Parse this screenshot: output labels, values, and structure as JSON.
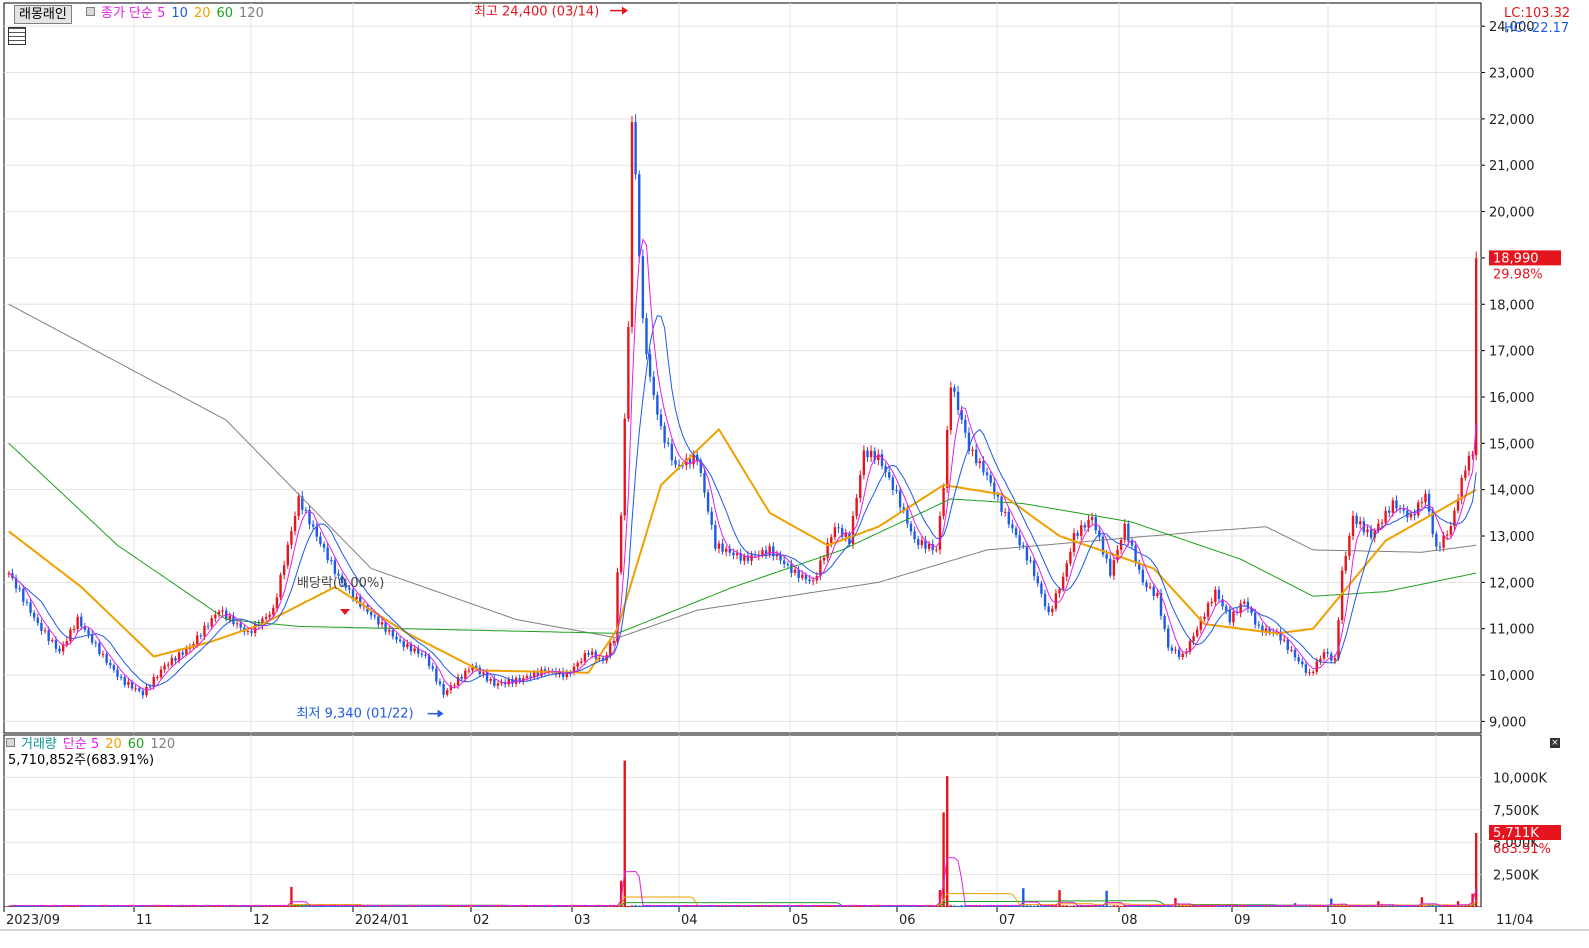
{
  "header": {
    "title": "래몽래인",
    "ma_legend": [
      {
        "label": "종가 단순 5",
        "color": "#e61ee6"
      },
      {
        "label": "10",
        "color": "#1e5ae6"
      },
      {
        "label": "20",
        "color": "#f0a000"
      },
      {
        "label": "60",
        "color": "#1ea01e"
      },
      {
        "label": "120",
        "color": "#808080"
      }
    ],
    "lc": "LC:103.32",
    "hc": "HC:-22.17"
  },
  "volume_header": {
    "legend": [
      {
        "label": "거래량",
        "color": "#0a9696"
      },
      {
        "label": "단순 5",
        "color": "#e61ee6"
      },
      {
        "label": "20",
        "color": "#f0a000"
      },
      {
        "label": "60",
        "color": "#1ea01e"
      },
      {
        "label": "120",
        "color": "#808080"
      }
    ],
    "volume_text": "5,710,852주(683.91%)"
  },
  "annotations": {
    "high": "최고 24,400 (03/14)",
    "low": "최저 9,340 (01/22)",
    "dividend": "배당락(0.00%)"
  },
  "price_badge": {
    "value": "18,990",
    "pct": "29.98%"
  },
  "volume_badge": {
    "value": "5,711K",
    "pct": "683.91%"
  },
  "chart_data": {
    "type": "candlestick",
    "price_axis": {
      "ylim": [
        8750,
        24500
      ],
      "ticks": [
        "9,000",
        "10,000",
        "11,000",
        "12,000",
        "13,000",
        "14,000",
        "15,000",
        "16,000",
        "17,000",
        "18,000",
        "19,000",
        "20,000",
        "21,000",
        "22,000",
        "23,000",
        "24,000"
      ]
    },
    "volume_axis": {
      "ylim": [
        0,
        12500
      ],
      "ticks": [
        "2,500K",
        "5,000K",
        "7,500K",
        "10,000K"
      ]
    },
    "x_axis": {
      "labels": [
        "2023/09",
        "11",
        "12",
        "2024/01",
        "02",
        "03",
        "04",
        "05",
        "06",
        "07",
        "08",
        "09",
        "10",
        "11",
        "11/04"
      ]
    },
    "colors": {
      "up": "#e6141e",
      "down": "#1e5ae6",
      "ma5": "#e61ee6",
      "ma10": "#1e5ae6",
      "ma20": "#f0a000",
      "ma60": "#1ea01e",
      "ma120": "#808080"
    },
    "close_knots": [
      [
        0,
        12200
      ],
      [
        8,
        11100
      ],
      [
        14,
        10500
      ],
      [
        19,
        11200
      ],
      [
        26,
        10400
      ],
      [
        31,
        9900
      ],
      [
        37,
        9600
      ],
      [
        43,
        10200
      ],
      [
        50,
        10600
      ],
      [
        58,
        11400
      ],
      [
        66,
        10900
      ],
      [
        73,
        11400
      ],
      [
        80,
        13800
      ],
      [
        85,
        13000
      ],
      [
        91,
        12100
      ],
      [
        95,
        11700
      ],
      [
        100,
        11300
      ],
      [
        108,
        10700
      ],
      [
        115,
        10400
      ],
      [
        120,
        9600
      ],
      [
        128,
        10200
      ],
      [
        134,
        9800
      ],
      [
        141,
        9900
      ],
      [
        148,
        10100
      ],
      [
        154,
        10000
      ],
      [
        160,
        10500
      ],
      [
        164,
        10300
      ],
      [
        167,
        10800
      ],
      [
        169,
        13500
      ],
      [
        171,
        17500
      ],
      [
        172,
        22000
      ],
      [
        173,
        20700
      ],
      [
        175,
        17600
      ],
      [
        177,
        16400
      ],
      [
        180,
        15300
      ],
      [
        184,
        14500
      ],
      [
        190,
        14700
      ],
      [
        195,
        12800
      ],
      [
        203,
        12500
      ],
      [
        210,
        12700
      ],
      [
        217,
        12200
      ],
      [
        222,
        12000
      ],
      [
        228,
        13200
      ],
      [
        232,
        12900
      ],
      [
        236,
        14800
      ],
      [
        240,
        14700
      ],
      [
        245,
        13900
      ],
      [
        250,
        12900
      ],
      [
        256,
        12700
      ],
      [
        258,
        14100
      ],
      [
        260,
        16300
      ],
      [
        263,
        15500
      ],
      [
        265,
        14900
      ],
      [
        270,
        14300
      ],
      [
        274,
        13600
      ],
      [
        278,
        13000
      ],
      [
        282,
        12400
      ],
      [
        287,
        11300
      ],
      [
        291,
        12100
      ],
      [
        294,
        13000
      ],
      [
        299,
        13400
      ],
      [
        304,
        12200
      ],
      [
        308,
        13200
      ],
      [
        313,
        12000
      ],
      [
        317,
        11700
      ],
      [
        320,
        10600
      ],
      [
        324,
        10400
      ],
      [
        328,
        11000
      ],
      [
        333,
        11800
      ],
      [
        337,
        11200
      ],
      [
        341,
        11600
      ],
      [
        345,
        11000
      ],
      [
        350,
        10900
      ],
      [
        355,
        10400
      ],
      [
        359,
        10000
      ],
      [
        363,
        10500
      ],
      [
        366,
        10300
      ],
      [
        368,
        12200
      ],
      [
        371,
        13400
      ],
      [
        376,
        13000
      ],
      [
        382,
        13700
      ],
      [
        387,
        13400
      ],
      [
        391,
        13900
      ],
      [
        394,
        12700
      ],
      [
        398,
        13200
      ],
      [
        402,
        14500
      ],
      [
        404,
        14800
      ],
      [
        405,
        18990
      ]
    ],
    "volume_spikes": [
      [
        78,
        1550
      ],
      [
        170,
        11300
      ],
      [
        258,
        7300
      ],
      [
        259,
        10100
      ],
      [
        280,
        1450
      ],
      [
        290,
        1300
      ],
      [
        303,
        1250
      ],
      [
        322,
        700
      ],
      [
        355,
        300
      ],
      [
        365,
        650
      ],
      [
        378,
        450
      ],
      [
        390,
        750
      ],
      [
        400,
        450
      ],
      [
        405,
        5711
      ]
    ],
    "ma120_knots": [
      [
        0,
        18000
      ],
      [
        60,
        15500
      ],
      [
        100,
        12300
      ],
      [
        140,
        11200
      ],
      [
        168,
        10800
      ],
      [
        190,
        11400
      ],
      [
        240,
        12000
      ],
      [
        270,
        12700
      ],
      [
        330,
        13100
      ],
      [
        347,
        13200
      ],
      [
        360,
        12700
      ],
      [
        390,
        12650
      ],
      [
        405,
        12800
      ]
    ],
    "ma60_knots": [
      [
        0,
        15000
      ],
      [
        30,
        12800
      ],
      [
        60,
        11200
      ],
      [
        80,
        11050
      ],
      [
        168,
        10900
      ],
      [
        200,
        11900
      ],
      [
        230,
        12700
      ],
      [
        260,
        13800
      ],
      [
        280,
        13700
      ],
      [
        310,
        13300
      ],
      [
        340,
        12500
      ],
      [
        360,
        11700
      ],
      [
        380,
        11800
      ],
      [
        405,
        12200
      ]
    ],
    "ma20_knots": [
      [
        0,
        13100
      ],
      [
        20,
        11900
      ],
      [
        40,
        10400
      ],
      [
        55,
        10700
      ],
      [
        70,
        11100
      ],
      [
        90,
        11900
      ],
      [
        110,
        10900
      ],
      [
        130,
        10100
      ],
      [
        160,
        10050
      ],
      [
        168,
        11000
      ],
      [
        180,
        14100
      ],
      [
        196,
        15300
      ],
      [
        210,
        13500
      ],
      [
        226,
        12800
      ],
      [
        240,
        13200
      ],
      [
        258,
        14100
      ],
      [
        274,
        13900
      ],
      [
        290,
        13000
      ],
      [
        316,
        12300
      ],
      [
        330,
        11100
      ],
      [
        350,
        10900
      ],
      [
        360,
        11000
      ],
      [
        380,
        12900
      ],
      [
        405,
        14000
      ]
    ]
  }
}
